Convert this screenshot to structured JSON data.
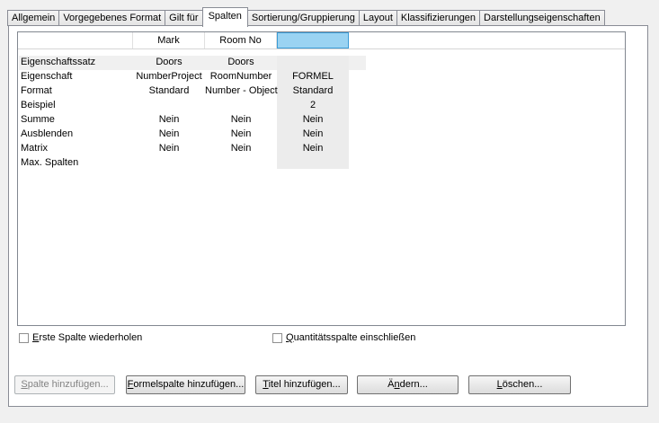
{
  "tabs": [
    {
      "label": "Allgemein"
    },
    {
      "label": "Vorgegebenes Format"
    },
    {
      "label": "Gilt für"
    },
    {
      "label": "Spalten"
    },
    {
      "label": "Sortierung/Gruppierung"
    },
    {
      "label": "Layout"
    },
    {
      "label": "Klassifizierungen"
    },
    {
      "label": "Darstellungseigenschaften"
    }
  ],
  "active_tab": "Spalten",
  "grid": {
    "columns": [
      "",
      "Mark",
      "Room No",
      ""
    ],
    "rows": [
      {
        "name": "Eigenschaftssatz",
        "cells": [
          "Doors",
          "Doors",
          ""
        ]
      },
      {
        "name": "Eigenschaft",
        "cells": [
          "NumberProject",
          "RoomNumber",
          "FORMEL"
        ]
      },
      {
        "name": "Format",
        "cells": [
          "Standard",
          "Number - Object",
          "Standard"
        ]
      },
      {
        "name": "Beispiel",
        "cells": [
          "",
          "",
          "2"
        ]
      },
      {
        "name": "Summe",
        "cells": [
          "Nein",
          "Nein",
          "Nein"
        ]
      },
      {
        "name": "Ausblenden",
        "cells": [
          "Nein",
          "Nein",
          "Nein"
        ]
      },
      {
        "name": "Matrix",
        "cells": [
          "Nein",
          "Nein",
          "Nein"
        ]
      },
      {
        "name": "Max. Spalten",
        "cells": [
          "",
          "",
          ""
        ]
      }
    ]
  },
  "options": {
    "repeat_first_column": {
      "first": "E",
      "rest": "rste Spalte wiederholen",
      "checked": false
    },
    "include_quantity_column": {
      "first": "Q",
      "rest": "uantitätsspalte einschließen",
      "checked": false
    }
  },
  "buttons": {
    "add_column": {
      "first": "S",
      "rest": "palte hinzufügen...",
      "enabled": false
    },
    "add_formula_column": {
      "first": "F",
      "rest": "ormelspalte hinzufügen...",
      "enabled": true
    },
    "add_title": {
      "first": "T",
      "rest": "itel hinzufügen...",
      "enabled": true
    },
    "modify": {
      "pre": "Ä",
      "mid": "n",
      "rest": "dern...",
      "enabled": true
    },
    "delete": {
      "first": "L",
      "rest": "öschen...",
      "enabled": true
    }
  }
}
